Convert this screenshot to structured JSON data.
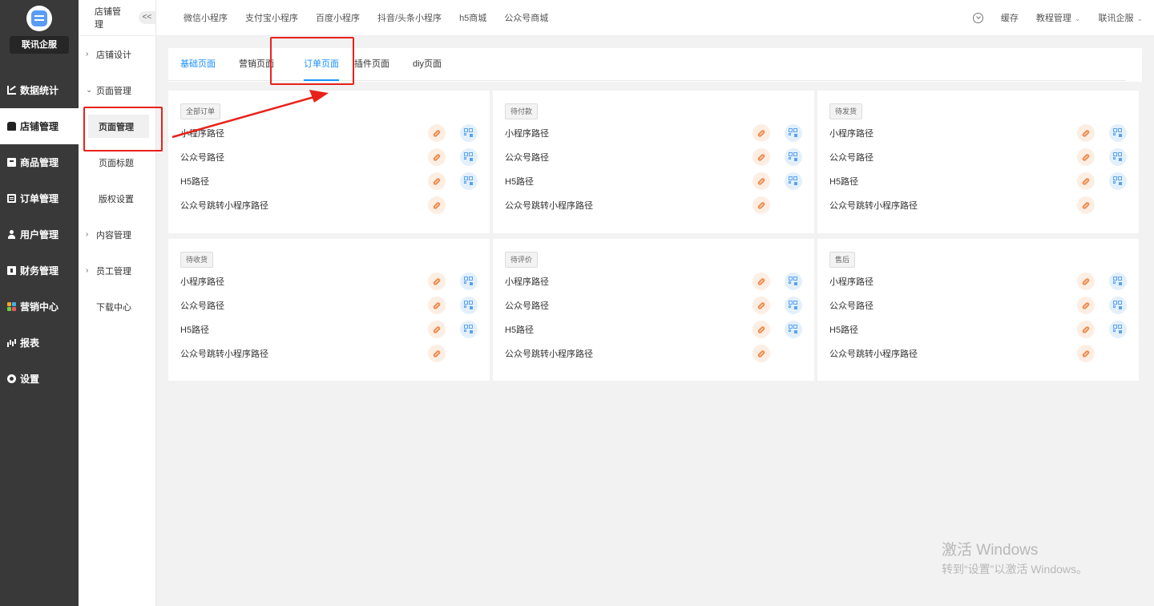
{
  "sidebar": {
    "logo_name": "联讯企服",
    "items": [
      {
        "label": "数据统计",
        "icon": "chart-icon"
      },
      {
        "label": "店铺管理",
        "icon": "shop-icon",
        "active": true
      },
      {
        "label": "商品管理",
        "icon": "goods-icon"
      },
      {
        "label": "订单管理",
        "icon": "order-icon"
      },
      {
        "label": "用户管理",
        "icon": "user-icon"
      },
      {
        "label": "财务管理",
        "icon": "finance-icon"
      },
      {
        "label": "营销中心",
        "icon": "marketing-icon"
      },
      {
        "label": "报表",
        "icon": "report-icon"
      },
      {
        "label": "设置",
        "icon": "settings-icon"
      }
    ]
  },
  "subbar": {
    "title": "店铺管理",
    "collapse": "<<",
    "items": {
      "shop_design": "店铺设计",
      "page_mgmt": "页面管理",
      "page_mgmt_child": "页面管理",
      "page_title": "页面标题",
      "copyright": "版权设置",
      "content_mgmt": "内容管理",
      "staff_mgmt": "员工管理",
      "download": "下载中心"
    }
  },
  "topbar": {
    "tabs": [
      "微信小程序",
      "支付宝小程序",
      "百度小程序",
      "抖音/头条小程序",
      "h5商城",
      "公众号商城"
    ],
    "cache": "缓存",
    "tutorial": "教程管理",
    "account": "联讯企服"
  },
  "page_tabs": {
    "basic": "基础页面",
    "marketing": "营销页面",
    "order": "订单页面",
    "plugin": "插件页面",
    "diy": "diy页面"
  },
  "path_labels": {
    "mini": "小程序路径",
    "mp": "公众号路径",
    "h5": "H5路径",
    "mp_to_mini": "公众号跳转小程序路径"
  },
  "cards": [
    {
      "tag": "全部订单"
    },
    {
      "tag": "待付款"
    },
    {
      "tag": "待发货"
    },
    {
      "tag": "待收货"
    },
    {
      "tag": "待评价"
    },
    {
      "tag": "售后"
    }
  ],
  "watermark": {
    "line1": "激活 Windows",
    "line2": "转到“设置”以激活 Windows。"
  },
  "colors": {
    "sidebar_bg": "#393939",
    "accent_blue": "#1890ff",
    "annotation_red": "#e8221b",
    "link_orange": "#f08a4b",
    "qr_blue": "#5aa2ef"
  }
}
